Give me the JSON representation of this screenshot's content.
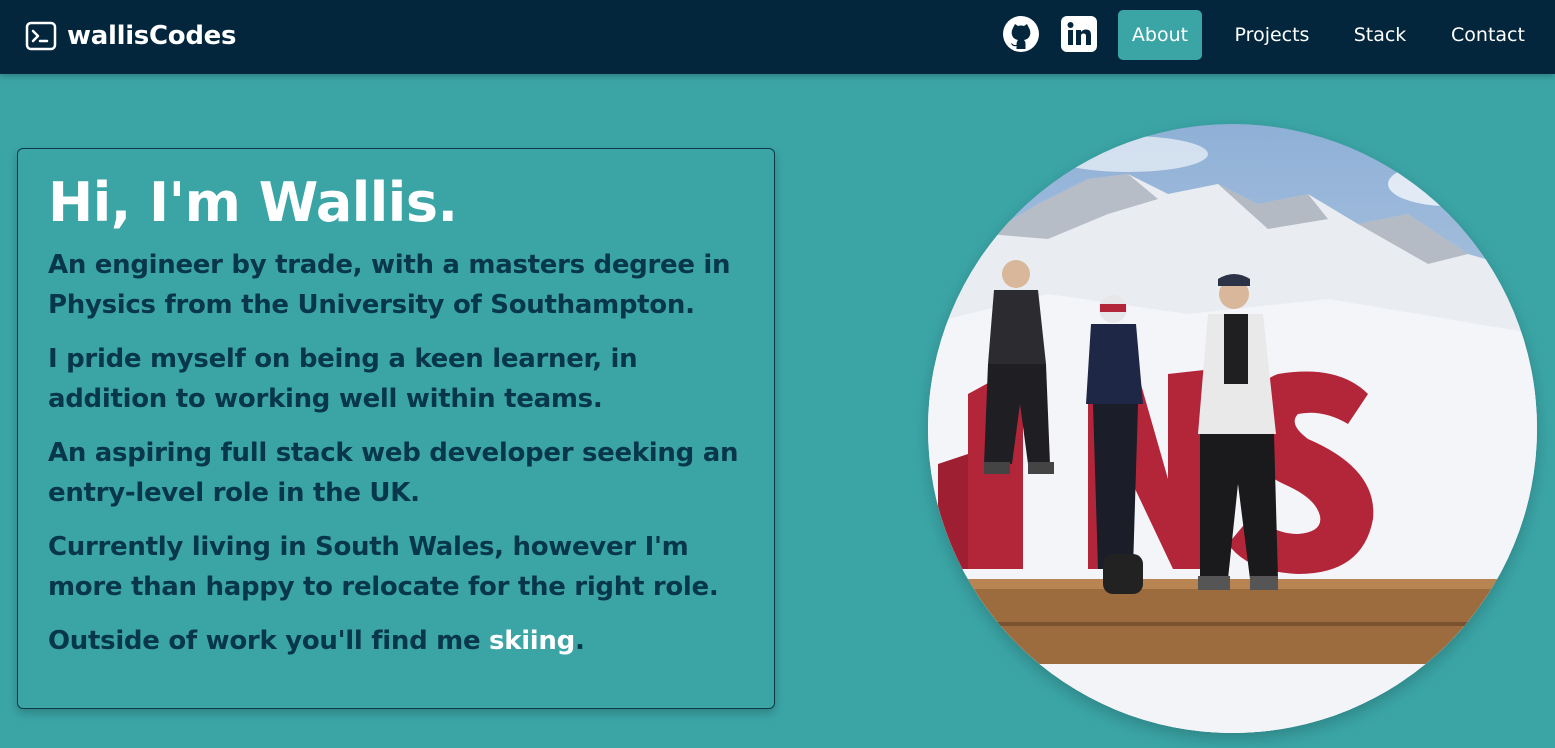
{
  "brand": {
    "name": "wallisCodes",
    "icon": "terminal-icon"
  },
  "nav": {
    "social": [
      {
        "name": "github-icon",
        "label": "GitHub"
      },
      {
        "name": "linkedin-icon",
        "label": "LinkedIn"
      }
    ],
    "items": [
      {
        "label": "About",
        "active": true
      },
      {
        "label": "Projects",
        "active": false
      },
      {
        "label": "Stack",
        "active": false
      },
      {
        "label": "Contact",
        "active": false
      }
    ]
  },
  "intro": {
    "title": "Hi, I'm Wallis.",
    "paragraphs": [
      "An engineer by trade, with a masters degree in Physics from the University of Southampton.",
      "I pride myself on being a keen learner, in addition to working well within teams.",
      "An aspiring full stack web developer seeking an entry-level role in the UK.",
      "Currently living in South Wales, however I'm more than happy to relocate for the right role."
    ],
    "outro_text": "Outside of work you'll find me ",
    "outro_link": "skiing",
    "outro_end": "."
  },
  "photo": {
    "name": "profile-photo",
    "sign_letters": "ENS"
  },
  "colors": {
    "navbar": "#03263c",
    "background": "#3ba5a6",
    "text_dark": "#08364a",
    "text_light": "#ffffff",
    "active_nav": "#3ba5a6"
  }
}
